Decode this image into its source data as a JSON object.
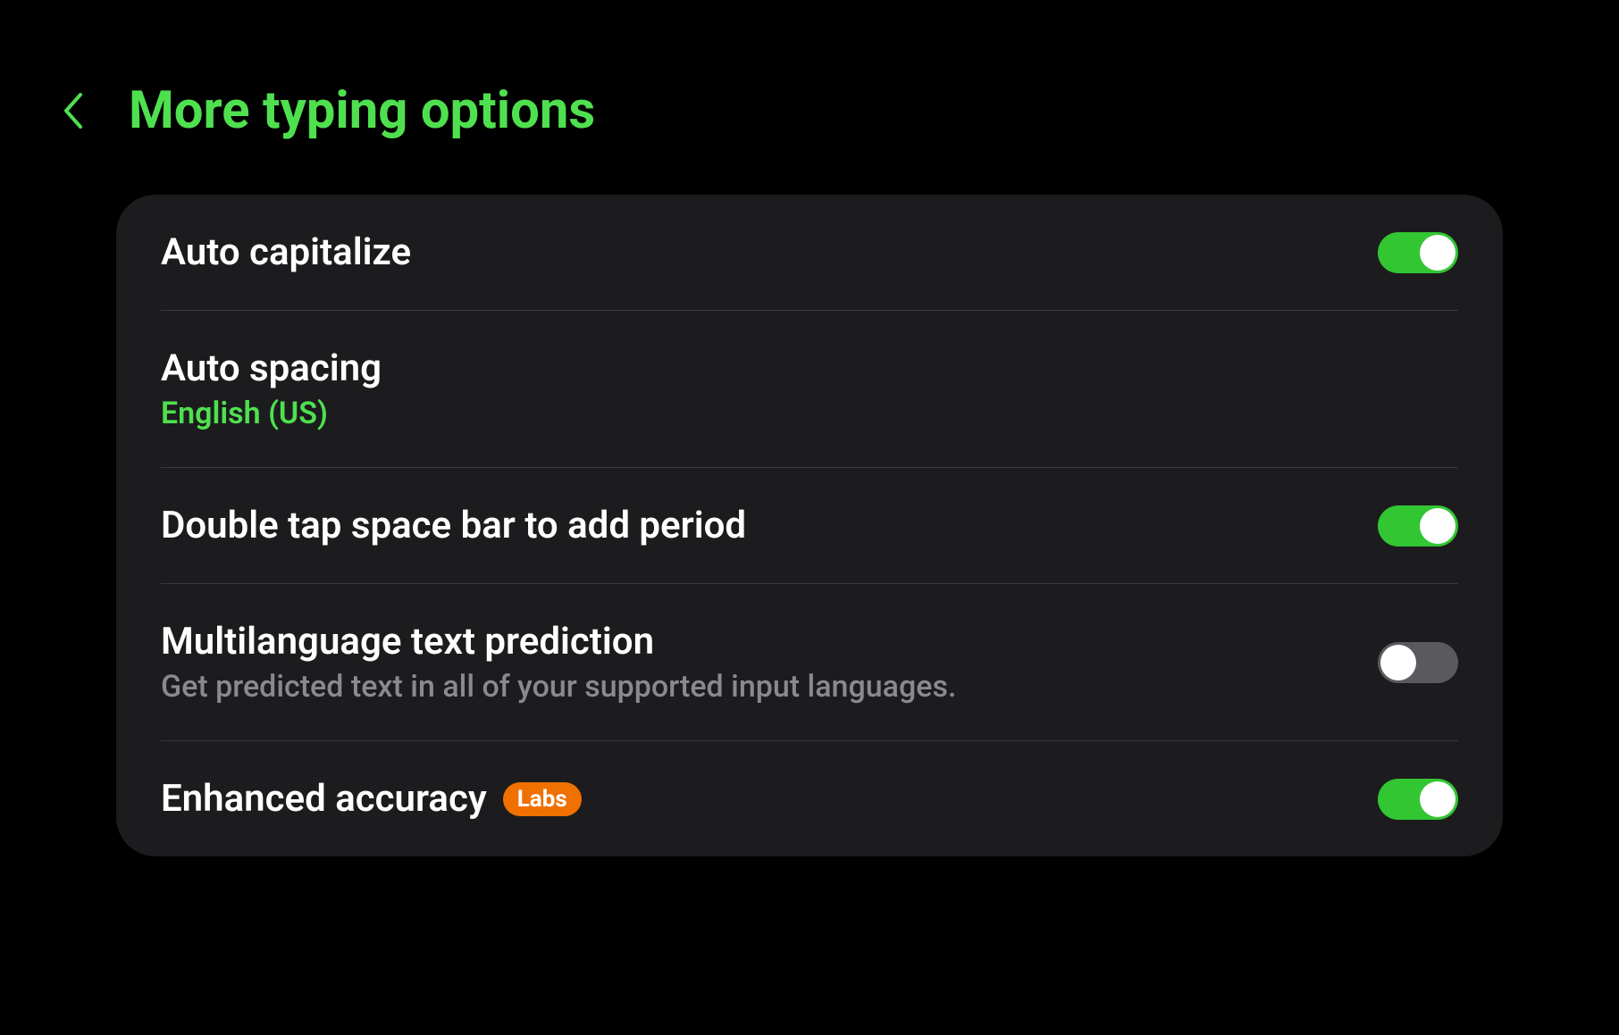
{
  "header": {
    "title": "More typing options"
  },
  "settings": {
    "auto_capitalize": {
      "title": "Auto capitalize",
      "enabled": true
    },
    "auto_spacing": {
      "title": "Auto spacing",
      "subtitle": "English (US)"
    },
    "double_tap": {
      "title": "Double tap space bar to add period",
      "enabled": true
    },
    "multilanguage": {
      "title": "Multilanguage text prediction",
      "subtitle": "Get predicted text in all of your supported input languages.",
      "enabled": false
    },
    "enhanced_accuracy": {
      "title": "Enhanced accuracy",
      "badge": "Labs",
      "enabled": true
    }
  },
  "colors": {
    "accent": "#4fe04f",
    "toggle_on": "#32c632",
    "badge": "#f07000"
  }
}
